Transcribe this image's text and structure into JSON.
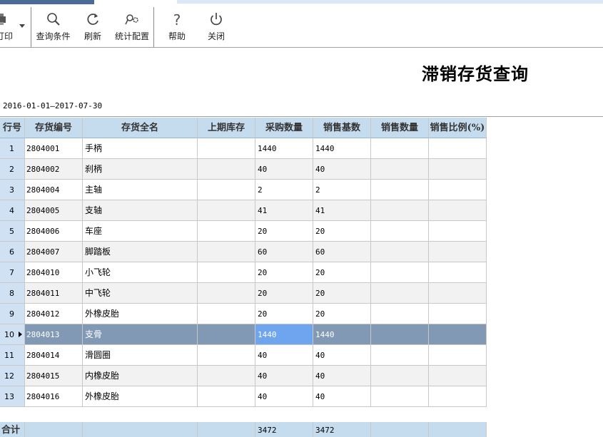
{
  "toolbar": {
    "print_label": "打印",
    "buttons": [
      {
        "label": "查询条件",
        "icon": "search-icon"
      },
      {
        "label": "刷新",
        "icon": "refresh-icon"
      },
      {
        "label": "统计配置",
        "icon": "config-icon"
      },
      {
        "label": "帮助",
        "icon": "help-icon"
      },
      {
        "label": "关闭",
        "icon": "power-icon"
      }
    ]
  },
  "report": {
    "title": "滞销存货查询",
    "date_range": "2016-01-01—2017-07-30"
  },
  "table": {
    "headers": [
      "行号",
      "存货编号",
      "存货全名",
      "上期库存",
      "采购数量",
      "销售基数",
      "销售数量",
      "销售比例(%)"
    ],
    "rows": [
      [
        "1",
        "2804001",
        "手柄",
        "",
        "1440",
        "1440",
        "",
        ""
      ],
      [
        "2",
        "2804002",
        "刹柄",
        "",
        "40",
        "40",
        "",
        ""
      ],
      [
        "3",
        "2804004",
        "主轴",
        "",
        "2",
        "2",
        "",
        ""
      ],
      [
        "4",
        "2804005",
        "支轴",
        "",
        "41",
        "41",
        "",
        ""
      ],
      [
        "5",
        "2804006",
        "车座",
        "",
        "20",
        "20",
        "",
        ""
      ],
      [
        "6",
        "2804007",
        "脚踏板",
        "",
        "60",
        "60",
        "",
        ""
      ],
      [
        "7",
        "2804010",
        "小飞轮",
        "",
        "20",
        "20",
        "",
        ""
      ],
      [
        "8",
        "2804011",
        "中飞轮",
        "",
        "20",
        "20",
        "",
        ""
      ],
      [
        "9",
        "2804012",
        "外橡皮胎",
        "",
        "20",
        "20",
        "",
        ""
      ],
      [
        "10",
        "2804013",
        "支骨",
        "",
        "1440",
        "1440",
        "",
        ""
      ],
      [
        "11",
        "2804014",
        "滑圆圈",
        "",
        "40",
        "40",
        "",
        ""
      ],
      [
        "12",
        "2804015",
        "内橡皮胎",
        "",
        "40",
        "40",
        "",
        ""
      ],
      [
        "13",
        "2804016",
        "外橡皮胎",
        "",
        "40",
        "40",
        "",
        ""
      ]
    ],
    "selected_row": 10,
    "total": {
      "label": "合计",
      "purchase": "3472",
      "sales_base": "3472"
    }
  },
  "colors": {
    "header_bg": "#c5dbee",
    "selected_row": "#8199b5",
    "focused_cell": "#6ea5ee",
    "title_tab": "#4a6b94"
  }
}
